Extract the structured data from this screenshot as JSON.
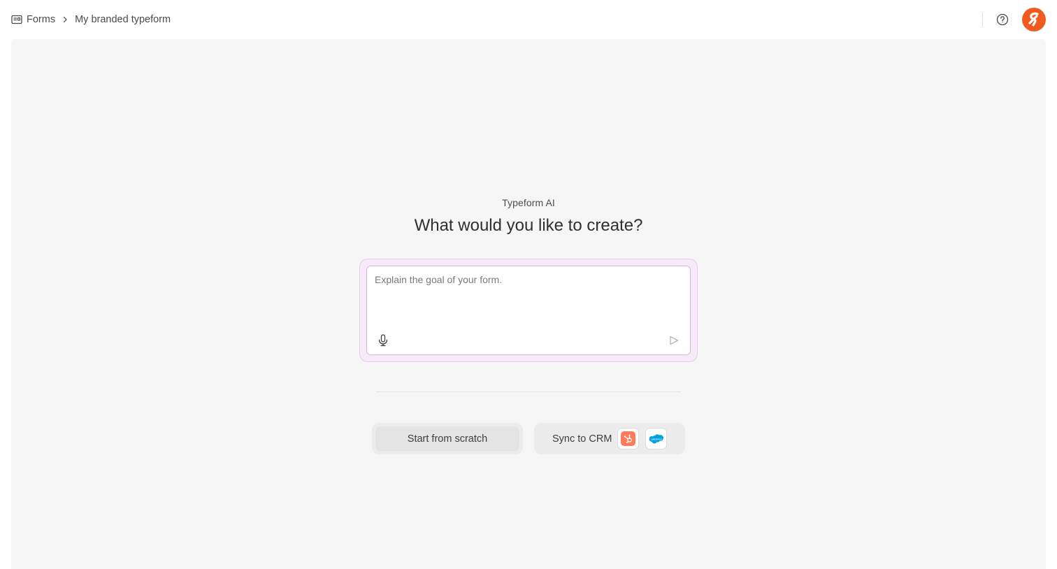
{
  "breadcrumb": {
    "root_label": "Forms",
    "current_label": "My branded typeform",
    "root_icon": "forms-icon",
    "separator_icon": "chevron-right-icon"
  },
  "header": {
    "help_icon": "help-circle-icon",
    "avatar_icon": "brand-logo-icon"
  },
  "main": {
    "eyebrow": "Typeform AI",
    "heading": "What would you like to create?",
    "prompt": {
      "placeholder": "Explain the goal of your form.",
      "value": "",
      "mic_icon": "microphone-icon",
      "send_icon": "send-icon"
    },
    "actions": {
      "scratch_label": "Start from scratch",
      "crm_label": "Sync to CRM",
      "crm_logos": [
        "hubspot-icon",
        "salesforce-icon"
      ]
    }
  },
  "colors": {
    "brand": "#f05a1f",
    "workspace_bg": "#f6f6f6",
    "prompt_glow": "#f6e9f8",
    "prompt_border": "#d8b6df",
    "hubspot": "#ff7a59",
    "salesforce": "#00a1e0"
  }
}
